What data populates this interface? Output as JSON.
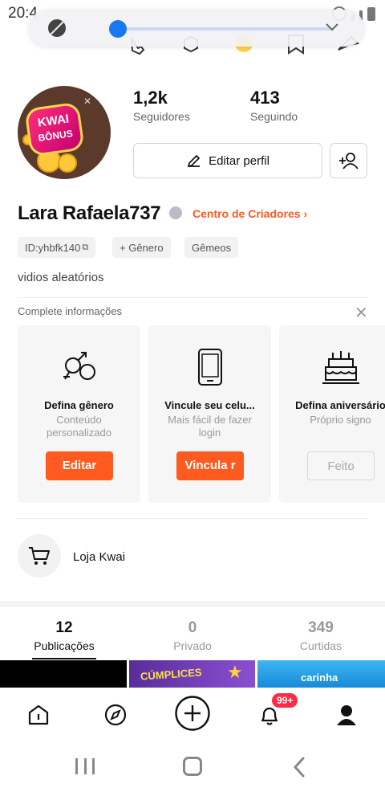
{
  "status_bar": {
    "time": "20:4"
  },
  "media_pill": {
    "progress": 0.0
  },
  "profile": {
    "avatar": {
      "line1": "KWAI",
      "line2": "BÔNUS"
    },
    "followers": {
      "count": "1,2k",
      "label": "Seguidores"
    },
    "following": {
      "count": "413",
      "label": "Seguindo"
    },
    "edit_label": "Editar perfil",
    "name": "Lara Rafaela737",
    "creators_link": "Centro de Criadores",
    "chips": [
      "ID:yhbfk140",
      "+ Gênero",
      "Gêmeos"
    ],
    "bio": "vidios aleatórios"
  },
  "complete": {
    "title": "Complete informações",
    "cards": [
      {
        "title": "Defina gênero",
        "subtitle": "Conteúdo personalizado",
        "button": "Editar",
        "icon": "gender-icon"
      },
      {
        "title": "Vincule seu celu...",
        "subtitle": "Mais fácil de fazer  login",
        "button": "Vincula r",
        "icon": "phone-icon"
      },
      {
        "title": "Defina aniversário",
        "subtitle": "Próprio signo",
        "button": "Feito",
        "icon": "cake-icon"
      }
    ]
  },
  "shop": {
    "label": "Loja Kwai"
  },
  "tabs": [
    {
      "count": "12",
      "label": "Publicações",
      "active": true
    },
    {
      "count": "0",
      "label": "Privado",
      "active": false
    },
    {
      "count": "349",
      "label": "Curtidas",
      "active": false
    }
  ],
  "thumbnails": {
    "t2": "CÚMPLICES",
    "t3": "carinha"
  },
  "bottom_nav": {
    "items": [
      "home-icon",
      "discover-icon",
      "create-icon",
      "notifications-icon",
      "profile-icon"
    ],
    "badge": "99+"
  },
  "colors": {
    "accent": "#ff5a1f",
    "badge": "#ff2b45",
    "knob": "#1877f2"
  }
}
